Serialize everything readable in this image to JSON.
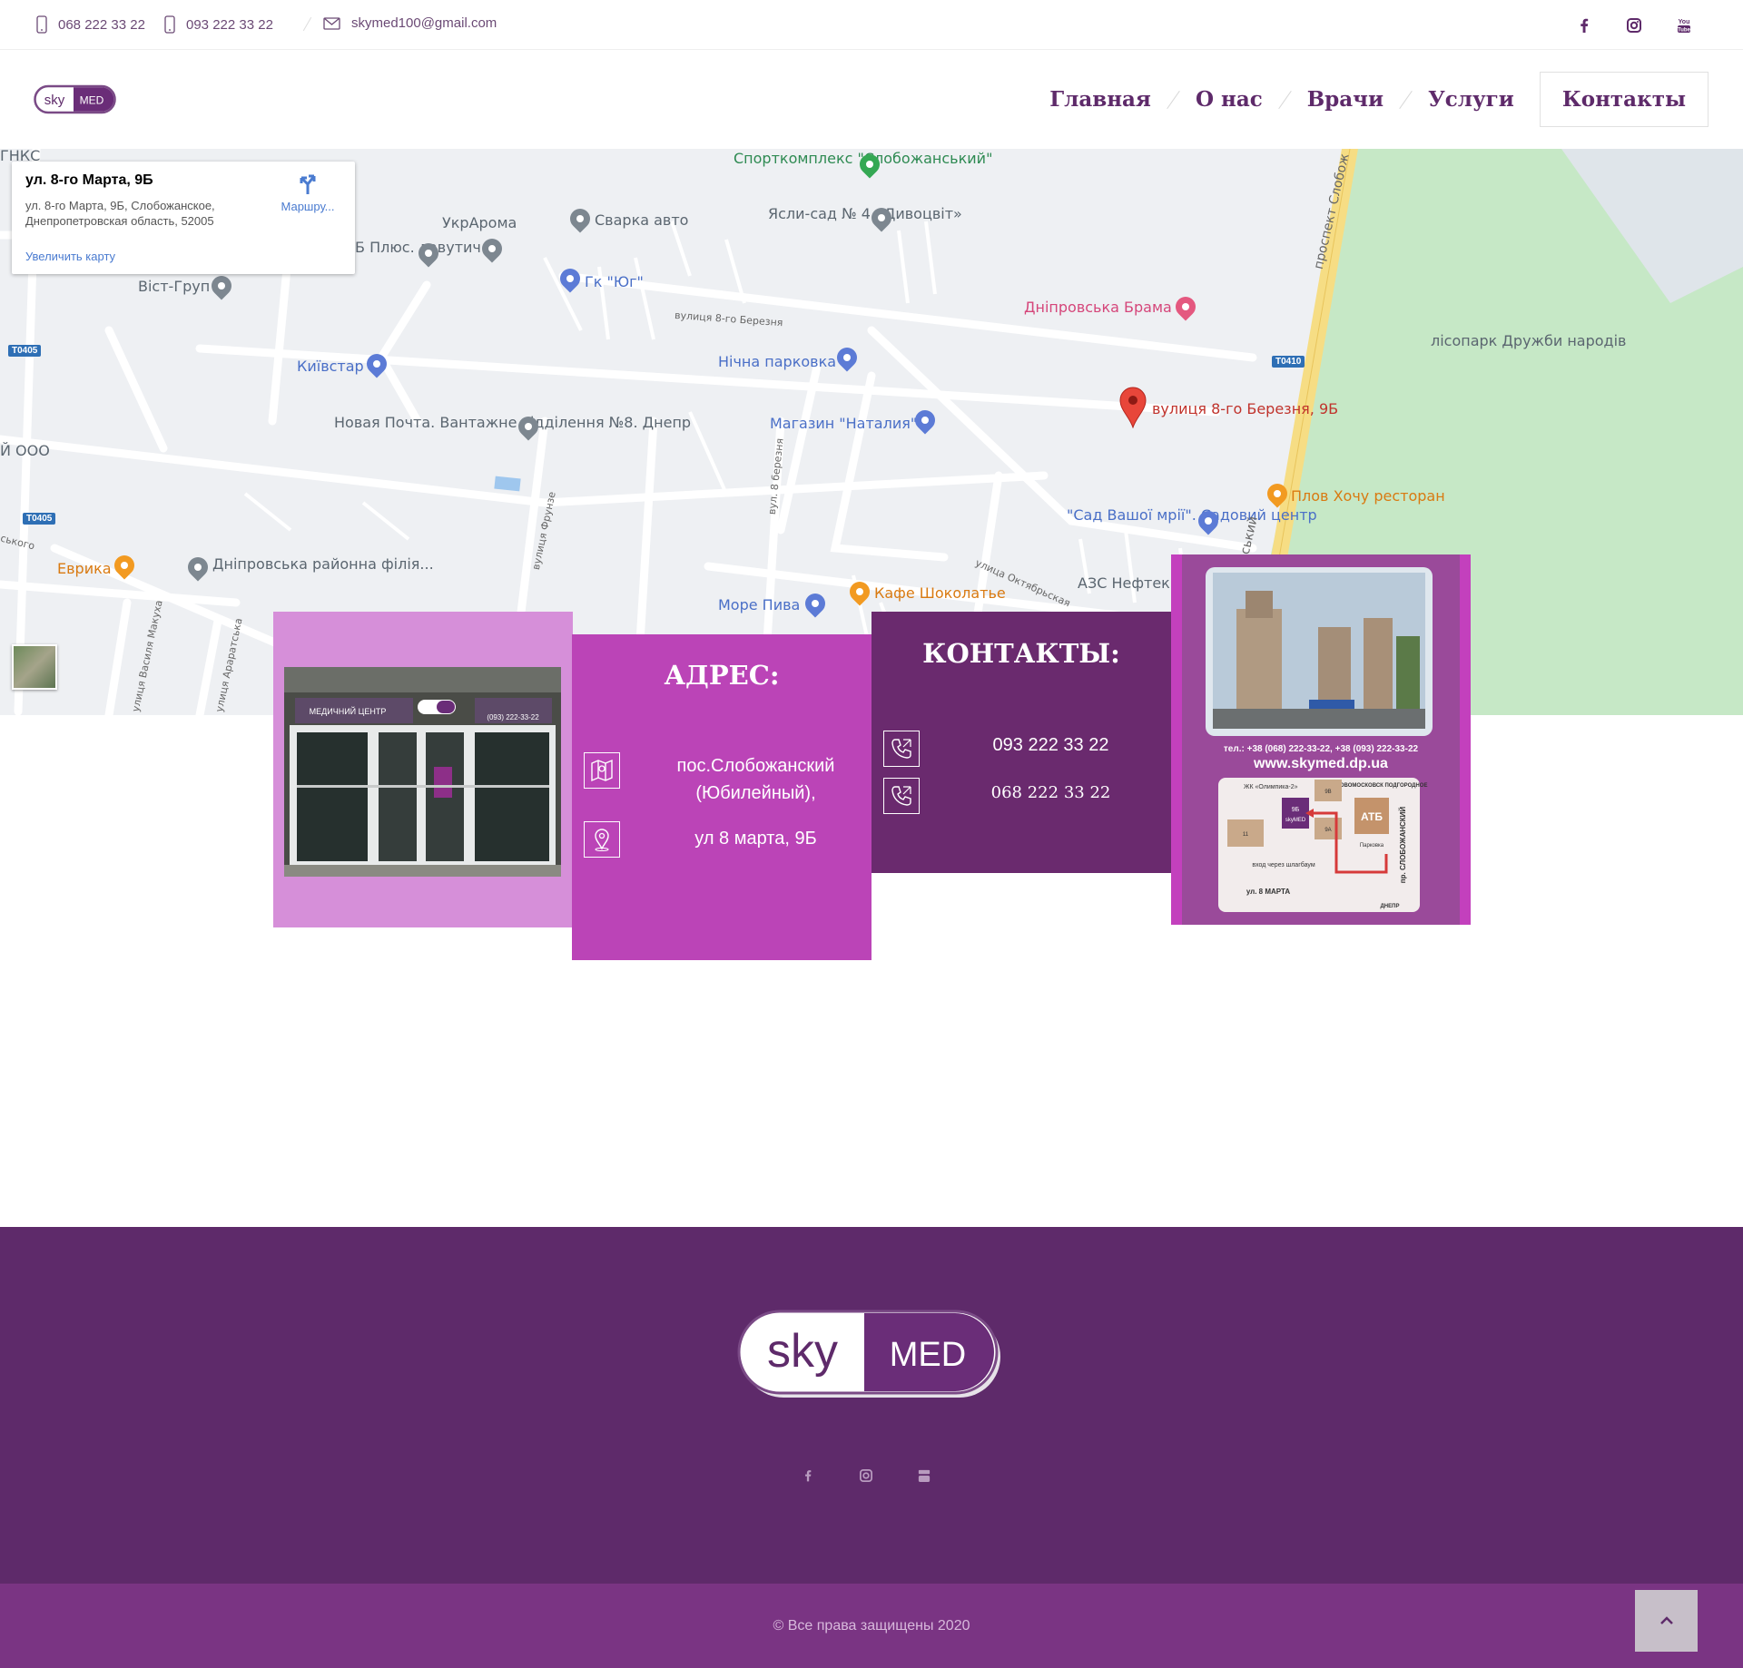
{
  "topbar": {
    "phone1": "068 222 33 22",
    "phone2": "093 222 33 22",
    "email": "skymed100@gmail.com",
    "social": [
      "facebook-icon",
      "instagram-icon",
      "youtube-icon"
    ]
  },
  "brand": {
    "logo_left": "sky",
    "logo_right": "MED",
    "purple": "#5e2a6a"
  },
  "nav": {
    "items": [
      "Главная",
      "О нас",
      "Врачи",
      "Услуги",
      "Контакты"
    ],
    "active": "Контакты"
  },
  "map": {
    "info_title": "ул. 8-го Марта, 9Б",
    "info_address": "ул. 8-го Марта, 9Б, Слобожанское, Днепропетровская область, 52005",
    "route_label": "Маршру...",
    "enlarge_label": "Увеличить карту",
    "marker_label": "вулиця 8-го Березня, 9Б",
    "places": [
      "Спорткомплекс \"Слобожанський\"",
      "Сварка авто",
      "УкрАрома",
      "Ясли-сад № 4 «Дивоцвіт»",
      "Б Плюс. лавутич",
      "Гк \"Юг\"",
      "Віст-Груп",
      "Дніпровська Брама",
      "Київстар",
      "Нічна парковка",
      "лісопарк Дружби народів",
      "Новая Почта. Вантажне відділення №8. Днепр",
      "Магазин \"Наталия\"",
      "Плов Хочу ресторан",
      "\"Сад Вашої мрії\". Садовий центр",
      "Еврика",
      "Дніпровська районна філія...",
      "Кафе Шоколатье",
      "АЗС Нефтек",
      "Море Пива",
      "ГНКС",
      "Й ООО"
    ],
    "streets": [
      "вулиця 8-го Березня",
      "проспект Слобож",
      "вул. 8 березня",
      "вулиця Фрунзе",
      "улица Октябрьская",
      "улиця Василя Макуха",
      "улиця Араратська",
      "ського",
      "ський"
    ],
    "road_codes": [
      "T0405",
      "T0405",
      "T0410"
    ]
  },
  "address_block": {
    "title": "АДРЕС:",
    "line1": "пос.Слобожанский (Юбилейный),",
    "line2": "ул 8 марта, 9Б"
  },
  "contacts_block": {
    "title": "КОНТАКТЫ:",
    "phone1": "093 222 33 22",
    "phone2": "068 222 33 22"
  },
  "flyer": {
    "phones": "тел.: +38 (068) 222-33-22, +38 (093) 222-33-22",
    "site": "www.skymed.dp.ua",
    "jk": "ЖК «Олимпика-2»",
    "novo": "НОВОМОСКОВСК ПОДГОРОДНОЕ",
    "atb": "АТБ",
    "parking": "Парковка",
    "entrance": "вход через шлагбаум",
    "street": "ул. 8 МАРТА",
    "prospect": "пр. СЛОБОЖАНСКИЙ",
    "dnepr": "ДНЕПР",
    "num9b": "9Б",
    "clinic": "skyMED",
    "n9": "9В",
    "n9a": "9А",
    "n11": "11"
  },
  "storefront": {
    "sign": "МЕДИЧНИЙ ЦЕНТР",
    "phone": "(093) 222-33-22"
  },
  "footer": {
    "copyright": "© Все права защищены 2020",
    "social": [
      "facebook-icon",
      "instagram-icon",
      "youtube-icon"
    ]
  }
}
